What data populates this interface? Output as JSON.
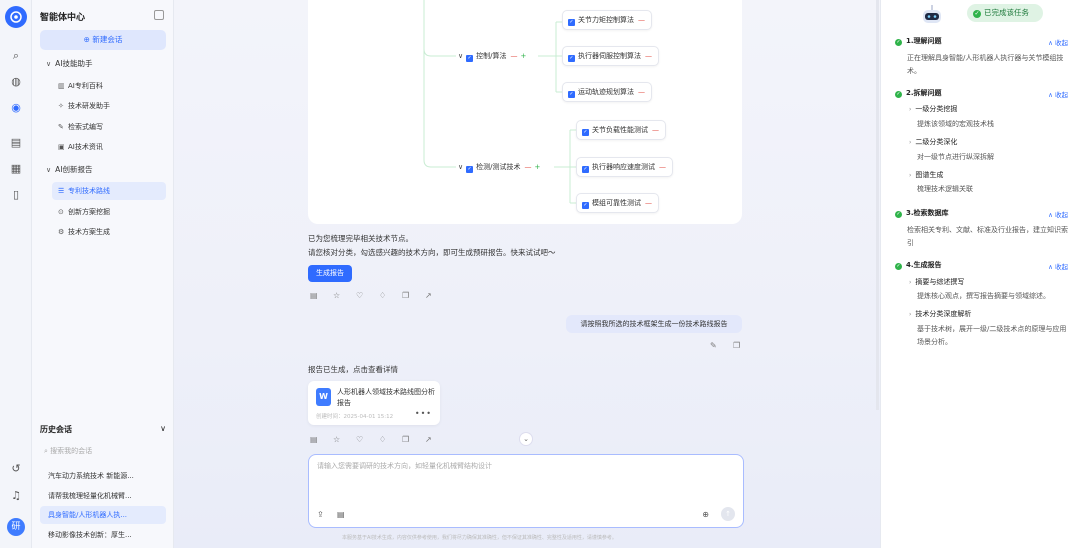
{
  "sidebar": {
    "title": "智能体中心",
    "new_chat": "新建会话",
    "sections": [
      {
        "label": "AI技能助手",
        "items": [
          "AI专利百科",
          "技术研发助手",
          "检索式编写",
          "AI技术资讯"
        ]
      },
      {
        "label": "AI创新报告",
        "items": [
          "专利技术路线",
          "创新方案挖掘",
          "技术方案生成"
        ]
      }
    ],
    "history_title": "历史会话",
    "history_search_placeholder": "搜索我的会话",
    "history": [
      "汽车动力系统技术 新能源...",
      "请帮我梳理轻量化机械臂...",
      "具身智能/人形机器人执...",
      "移动影像技术创新：厚生..."
    ]
  },
  "mindmap": {
    "categories": [
      "控制/算法",
      "检测/测试技术"
    ],
    "control_nodes": [
      "关节力矩控制算法",
      "执行器伺服控制算法",
      "运动轨迹规划算法"
    ],
    "test_nodes": [
      "关节负载性能测试",
      "执行器响应速度测试",
      "模组可靠性测试"
    ],
    "minus": "—",
    "plus": "+"
  },
  "chat": {
    "assistant_msg_line1": "已为您梳理完毕相关技术节点。",
    "assistant_msg_line2": "请您核对分类，勾选感兴趣的技术方向，即可生成预研报告。快来试试吧～",
    "generate_button": "生成报告",
    "user_msg": "请按照我所选的技术框架生成一份技术路线报告",
    "report_msg": "报告已生成，点击查看详情",
    "file_name": "人形机器人领域技术路线图分析报告",
    "file_meta": "创建时间：2025-04-01 15:12",
    "input_placeholder": "请输入您需要调研的技术方向，如轻量化机械臂结构设计",
    "footer": "本服务基于AI技术生成，内容仅供参考使用，我们将尽力确保其准确性，但不保证其准确性、完整性及适用性，请谨慎参考。"
  },
  "right_panel": {
    "status": "已完成该任务",
    "fold_label": "收起",
    "steps": [
      {
        "title": "1.理解问题",
        "desc": "正在理解具身智能/人形机器人执行器与关节模组技术。"
      },
      {
        "title": "2.拆解问题",
        "subs": [
          {
            "title": "一级分类挖掘",
            "desc": "提炼该领域的宏观技术栈"
          },
          {
            "title": "二级分类深化",
            "desc": "对一级节点进行纵深拆解"
          },
          {
            "title": "图谱生成",
            "desc": "梳理技术逻辑关联"
          }
        ]
      },
      {
        "title": "3.检索数据库",
        "desc": "检索相关专利、文献、标准及行业报告，建立知识索引"
      },
      {
        "title": "4.生成报告",
        "subs": [
          {
            "title": "摘要与综述撰写",
            "desc": "提炼核心观点，撰写报告摘要与领域综述。"
          },
          {
            "title": "技术分类深度解析",
            "desc": "基于技术树，展开一级/二级技术点的原理与应用场景分析。"
          }
        ]
      }
    ]
  },
  "colors": {
    "accent": "#2f6bff",
    "success": "#2fb34a",
    "danger": "#e0473c"
  }
}
